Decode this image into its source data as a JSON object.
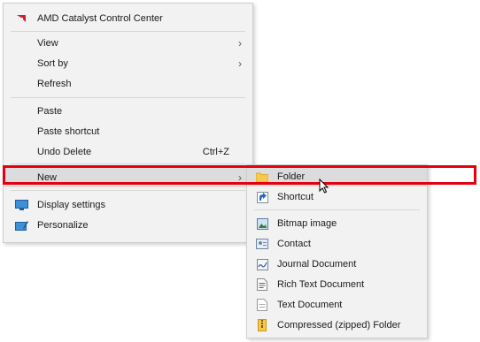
{
  "context_menu": {
    "top_item": {
      "label": "AMD Catalyst Control Center",
      "icon": "amd-logo-icon",
      "icon_color": "#d11f2a"
    },
    "view": {
      "label": "View"
    },
    "sort_by": {
      "label": "Sort by"
    },
    "refresh": {
      "label": "Refresh"
    },
    "paste": {
      "label": "Paste"
    },
    "paste_shortcut": {
      "label": "Paste shortcut"
    },
    "undo_delete": {
      "label": "Undo Delete",
      "shortcut": "Ctrl+Z"
    },
    "new": {
      "label": "New",
      "highlighted": true
    },
    "display_settings": {
      "label": "Display settings",
      "icon": "display-icon"
    },
    "personalize": {
      "label": "Personalize",
      "icon": "personalize-icon"
    }
  },
  "new_submenu": {
    "folder": {
      "label": "Folder",
      "icon": "folder-icon",
      "highlighted": true
    },
    "shortcut": {
      "label": "Shortcut",
      "icon": "shortcut-icon"
    },
    "bitmap": {
      "label": "Bitmap image",
      "icon": "bitmap-icon"
    },
    "contact": {
      "label": "Contact",
      "icon": "contact-icon"
    },
    "journal": {
      "label": "Journal Document",
      "icon": "journal-icon"
    },
    "rtf": {
      "label": "Rich Text Document",
      "icon": "rich-text-icon"
    },
    "text": {
      "label": "Text Document",
      "icon": "text-document-icon"
    },
    "zip": {
      "label": "Compressed (zipped) Folder",
      "icon": "zip-folder-icon"
    }
  },
  "colors": {
    "highlight_box": "#e3000f",
    "menu_bg": "#f2f2f2",
    "hover_bg": "#dcdcdc"
  }
}
